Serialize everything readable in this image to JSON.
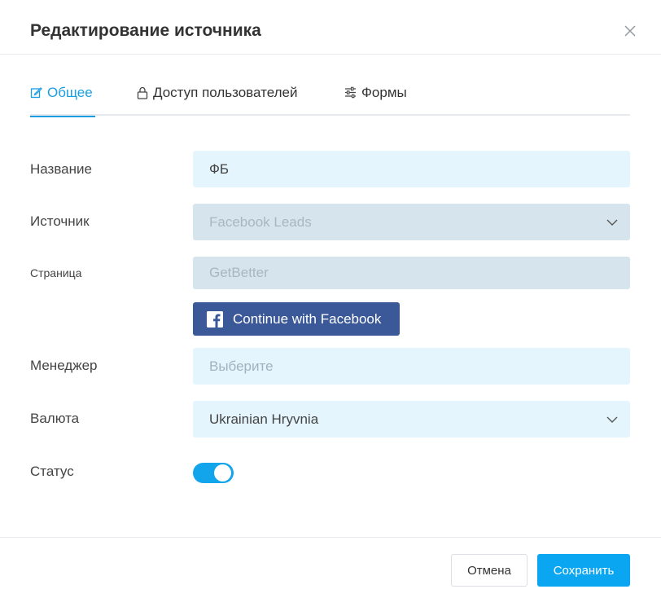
{
  "header": {
    "title": "Редактирование источника"
  },
  "tabs": [
    {
      "label": "Общее",
      "icon": "edit-icon",
      "active": true
    },
    {
      "label": "Доступ пользователей",
      "icon": "lock-icon",
      "active": false
    },
    {
      "label": "Формы",
      "icon": "sliders-icon",
      "active": false
    }
  ],
  "form": {
    "name": {
      "label": "Название",
      "value": "ФБ"
    },
    "source": {
      "label": "Источник",
      "value": "Facebook Leads"
    },
    "page": {
      "label": "Страница",
      "value": "GetBetter"
    },
    "facebook_button": {
      "label": "Continue with Facebook",
      "color": "#3b5998"
    },
    "manager": {
      "label": "Менеджер",
      "placeholder": "Выберите"
    },
    "currency": {
      "label": "Валюта",
      "value": "Ukrainian Hryvnia"
    },
    "status": {
      "label": "Статус",
      "enabled": true
    }
  },
  "footer": {
    "cancel_label": "Отмена",
    "save_label": "Сохранить"
  },
  "colors": {
    "accent": "#1a9ee2",
    "primary_button": "#0aa6f1",
    "field_bg": "#e5f5fd",
    "field_disabled_bg": "#d6e5ed"
  }
}
